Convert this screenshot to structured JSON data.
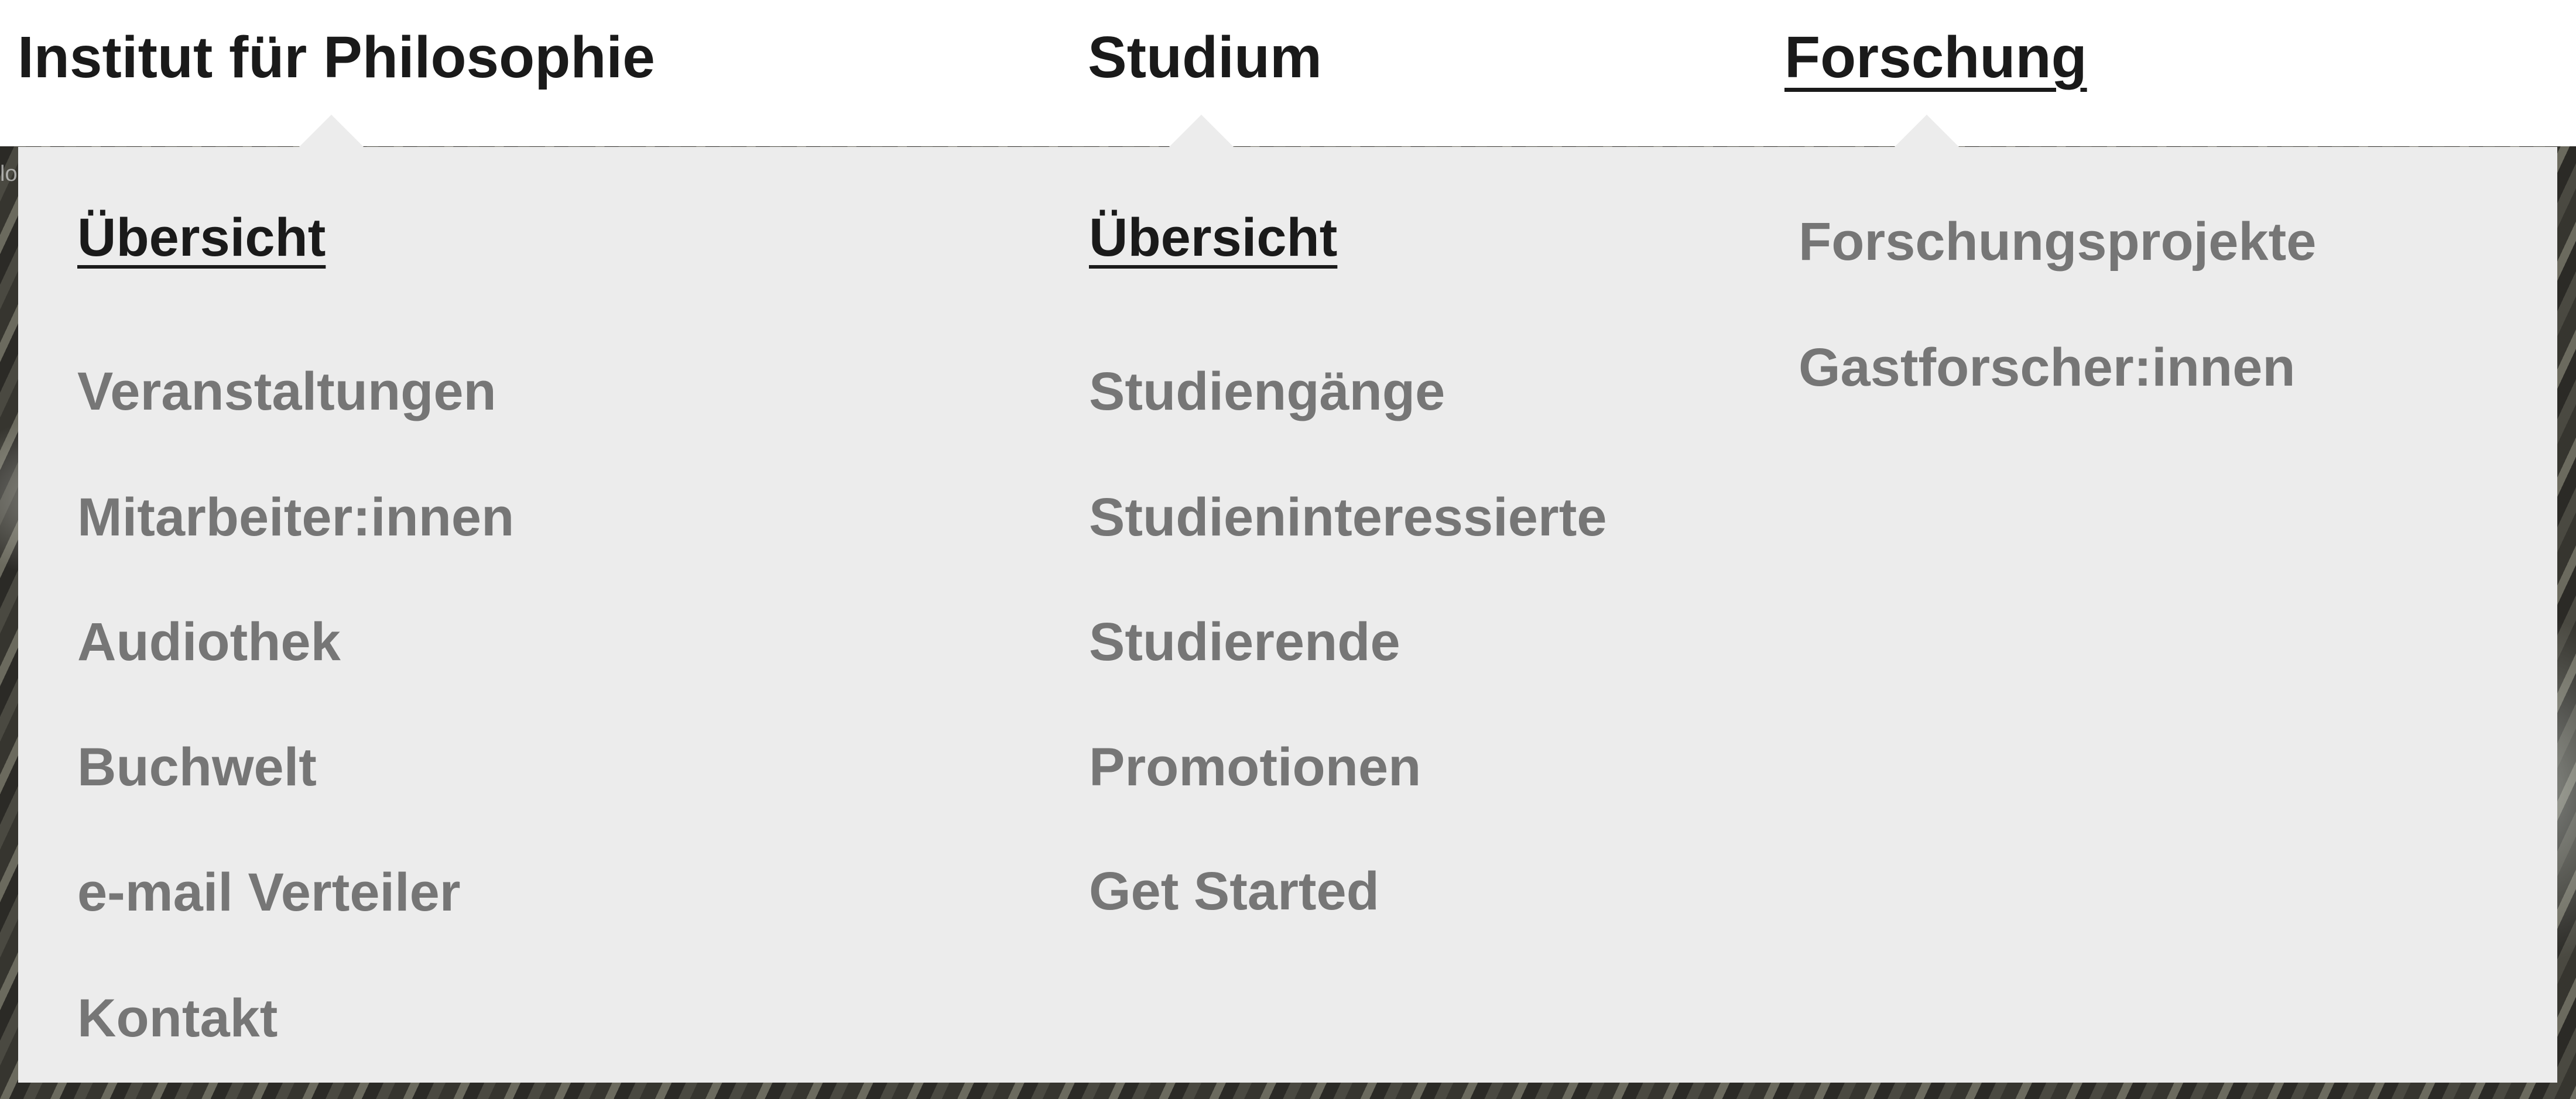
{
  "nav": {
    "top_items": [
      {
        "label": "Institut für Philosophie",
        "active": false
      },
      {
        "label": "Studium",
        "active": false
      },
      {
        "label": "Forschung",
        "active": true
      }
    ]
  },
  "dropdown": {
    "columns": [
      {
        "items": [
          "Übersicht",
          "Veranstaltungen",
          "Mitarbeiter:innen",
          "Audiothek",
          "Buchwelt",
          "e-mail Verteiler",
          "Kontakt"
        ]
      },
      {
        "items": [
          "Übersicht",
          "Studiengänge",
          "Studieninteressierte",
          "Studierende",
          "Promotionen",
          "Get Started"
        ]
      },
      {
        "items": [
          "Forschungsprojekte",
          "Gastforscher:innen"
        ]
      }
    ]
  },
  "background": {
    "caption_fragment": "lo"
  },
  "colors": {
    "panel_bg": "#ececec",
    "link_muted": "#767676",
    "link_active": "#1a1a1a",
    "header_bg": "#ffffff"
  }
}
